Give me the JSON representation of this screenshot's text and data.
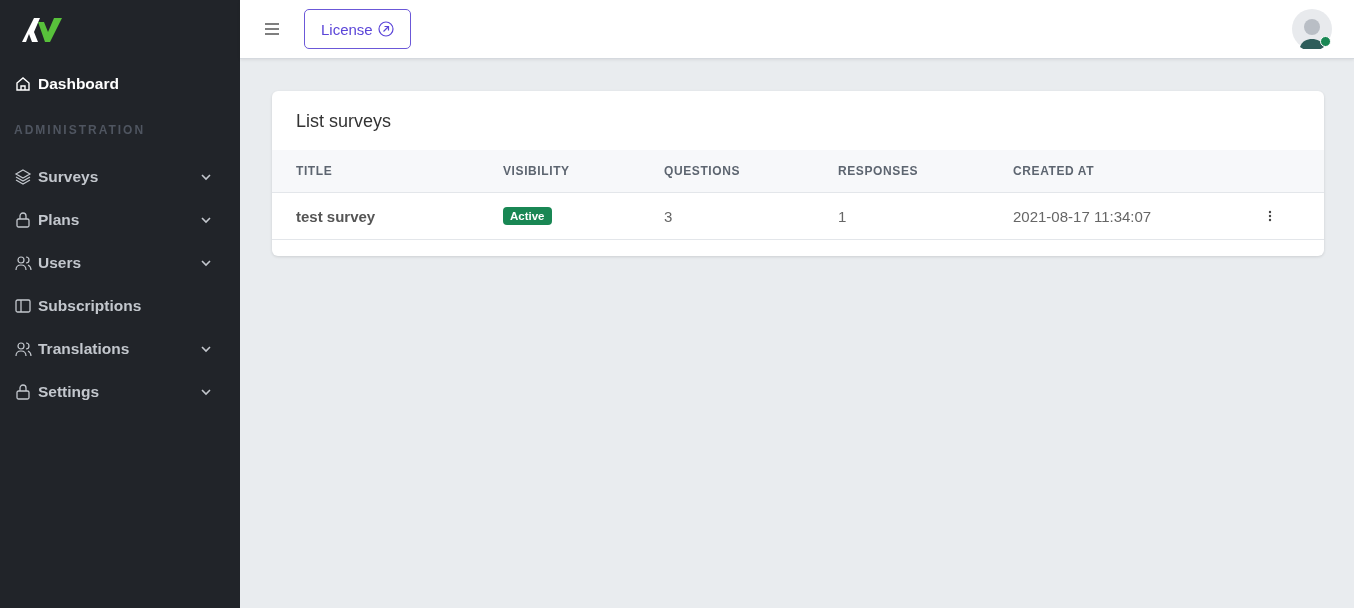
{
  "sidebar": {
    "items": [
      {
        "label": "Dashboard",
        "kind": "link",
        "selected": true
      },
      {
        "label": "ADMINISTRATION",
        "kind": "heading"
      },
      {
        "label": "Surveys",
        "kind": "link",
        "selected": false,
        "expandable": true
      },
      {
        "label": "Plans",
        "kind": "link",
        "selected": false,
        "expandable": true
      },
      {
        "label": "Users",
        "kind": "link",
        "selected": false,
        "expandable": true
      },
      {
        "label": "Subscriptions",
        "kind": "link",
        "selected": false,
        "expandable": false
      },
      {
        "label": "Translations",
        "kind": "link",
        "selected": false,
        "expandable": true
      },
      {
        "label": "Settings",
        "kind": "link",
        "selected": false,
        "expandable": true
      }
    ]
  },
  "topbar": {
    "license_button": "License",
    "user": {
      "online": true
    }
  },
  "card": {
    "title": "List surveys",
    "table": {
      "columns": [
        "TITLE",
        "VISIBILITY",
        "QUESTIONS",
        "RESPONSES",
        "CREATED AT"
      ],
      "rows": [
        {
          "title": "test survey",
          "visibility": "Active",
          "questions": "3",
          "responses": "1",
          "created_at": "2021-08-17 11:34:07"
        }
      ]
    }
  }
}
